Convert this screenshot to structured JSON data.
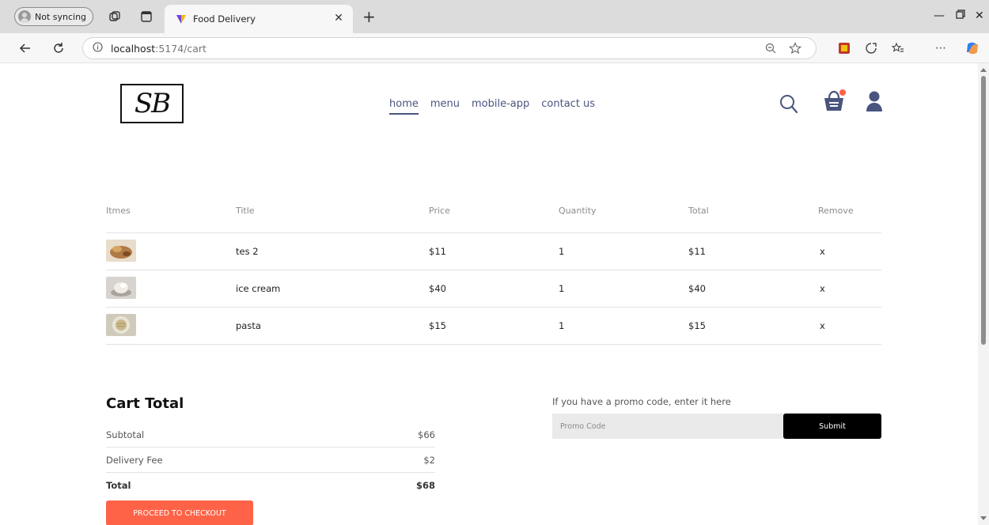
{
  "browser": {
    "sync_label": "Not syncing",
    "tab_title": "Food Delivery",
    "url_host": "localhost",
    "url_path": ":5174/cart"
  },
  "nav": {
    "logo_text": "SB",
    "menu": [
      {
        "label": "home",
        "active": true
      },
      {
        "label": "menu"
      },
      {
        "label": "mobile-app"
      },
      {
        "label": "contact us"
      }
    ],
    "cart_dot_color": "#ff6347",
    "icon_color": "#49557e"
  },
  "cart": {
    "headers": [
      "Itmes",
      "Title",
      "Price",
      "Quantity",
      "Total",
      "Remove"
    ],
    "items": [
      {
        "title": "tes 2",
        "price": "$11",
        "quantity": "1",
        "total": "$11",
        "remove": "x",
        "thumb_color": "#b07a44"
      },
      {
        "title": "ice cream",
        "price": "$40",
        "quantity": "1",
        "total": "$40",
        "remove": "x",
        "thumb_color": "#c9c4bd"
      },
      {
        "title": "pasta",
        "price": "$15",
        "quantity": "1",
        "total": "$15",
        "remove": "x",
        "thumb_color": "#b9b39c"
      }
    ]
  },
  "totals": {
    "title": "Cart Total",
    "subtotal_label": "Subtotal",
    "subtotal_value": "$66",
    "delivery_label": "Delivery Fee",
    "delivery_value": "$2",
    "total_label": "Total",
    "total_value": "$68",
    "checkout_label": "PROCEED TO CHECKOUT",
    "checkout_color": "#ff6347"
  },
  "promo": {
    "label": "If you have a promo code, enter it here",
    "placeholder": "Promo Code",
    "value": "",
    "submit_label": "Submit"
  }
}
